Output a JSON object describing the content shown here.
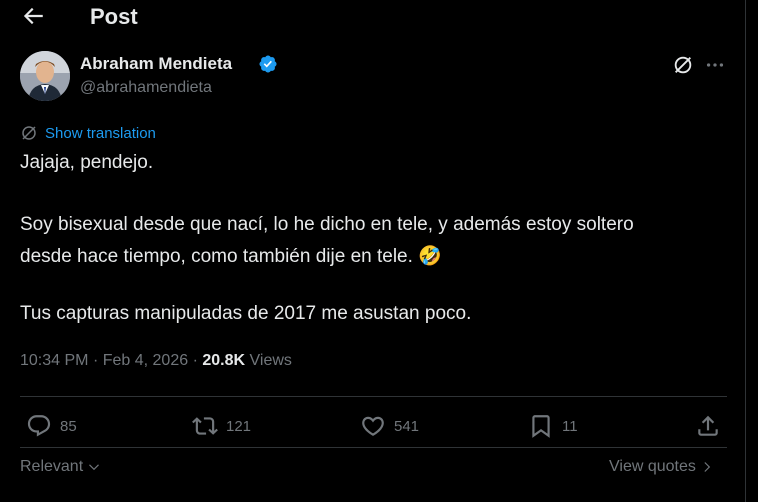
{
  "header": {
    "title": "Post",
    "back_icon": "arrow-left-icon"
  },
  "author": {
    "name": "Abraham Mendieta",
    "handle": "@abrahamendieta",
    "verified": true,
    "verified_color": "#1d9bf0"
  },
  "translation": {
    "label": "Show translation",
    "color": "#1d9bf0"
  },
  "tweet": {
    "lines": [
      "Jajaja, pendejo.",
      "Soy bisexual desde que nací, lo he dicho en tele, y además estoy soltero",
      "desde hace tiempo, como también dije en tele. 🤣",
      "Tus capturas manipuladas de 2017 me asustan poco."
    ]
  },
  "meta": {
    "time": "10:34 PM",
    "date": "Feb 4, 2026",
    "views_count": "20.8K",
    "views_label": "Views"
  },
  "actions": {
    "replies": "85",
    "reposts": "121",
    "likes": "541",
    "bookmarks": "11"
  },
  "footer": {
    "sort_label": "Relevant",
    "quotes_label": "View quotes"
  }
}
